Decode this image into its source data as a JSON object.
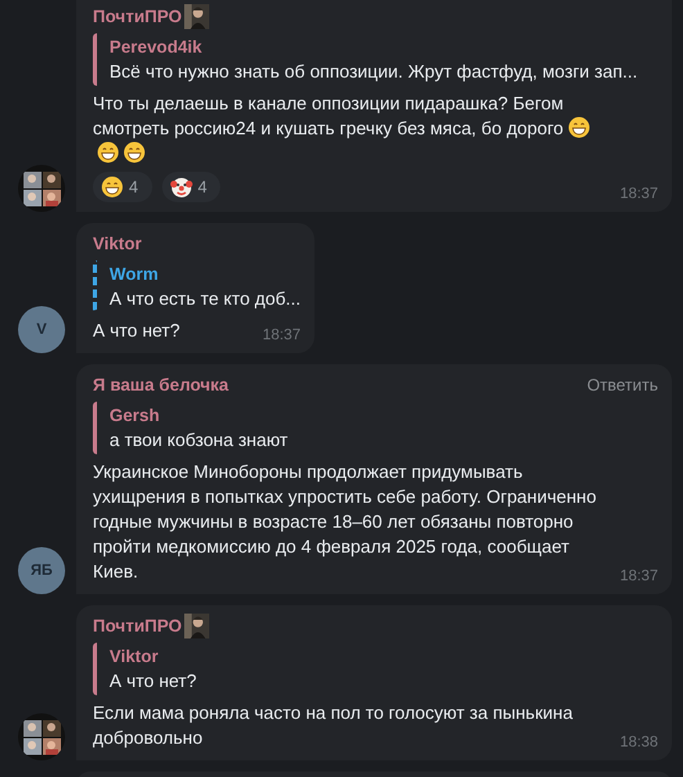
{
  "messages": [
    {
      "author": "ПочтиПРО",
      "author_badge": {
        "kind": "picture"
      },
      "avatar": {
        "kind": "picture"
      },
      "reply": {
        "author": "Perevod4ik",
        "text": "Всё что нужно знать об оппозиции. Жрут фастфуд, мозги зап...",
        "kind": "plain",
        "color": "#c87b8c"
      },
      "text": "Что ты делаешь в канале оппозиции пидарашка? Бегом смотреть россию24 и кушать гречку без мяса, бо дорого",
      "trailing_emoji": [
        {
          "kind": "grin"
        },
        {
          "kind": "grin"
        },
        {
          "kind": "grin"
        }
      ],
      "reactions": [
        {
          "kind": "grin",
          "count": "4"
        },
        {
          "kind": "clown",
          "count": "4"
        }
      ],
      "time": "18:37"
    },
    {
      "author": "Viktor",
      "avatar": {
        "kind": "initials",
        "text": "V"
      },
      "reply": {
        "author": "Worm",
        "text": "А что есть те кто доб...",
        "kind": "striped",
        "color": "#3ea6e6"
      },
      "text": "А что нет?",
      "time": "18:37"
    },
    {
      "author": "Я ваша белочка",
      "action": "Ответить",
      "avatar": {
        "kind": "initials",
        "text": "ЯБ"
      },
      "reply": {
        "author": "Gersh",
        "text": "а твои кобзона знают",
        "kind": "plain",
        "color": "#c87b8c"
      },
      "text": "Украинское Минобороны продолжает придумывать ухищрения в попытках упростить себе работу. Ограниченно годные мужчины в возрасте 18–60 лет обязаны повторно пройти медкомиссию до 4 февраля 2025 года, сообщает Киев.",
      "time": "18:37"
    },
    {
      "author": "ПочтиПРО",
      "author_badge": {
        "kind": "picture"
      },
      "avatar": {
        "kind": "picture"
      },
      "reply": {
        "author": "Viktor",
        "text": "А что нет?",
        "kind": "plain",
        "color": "#c87b8c"
      },
      "text": "Если мама роняла часто на пол то голосуют за пынькина добровольно",
      "time": "18:38"
    }
  ]
}
